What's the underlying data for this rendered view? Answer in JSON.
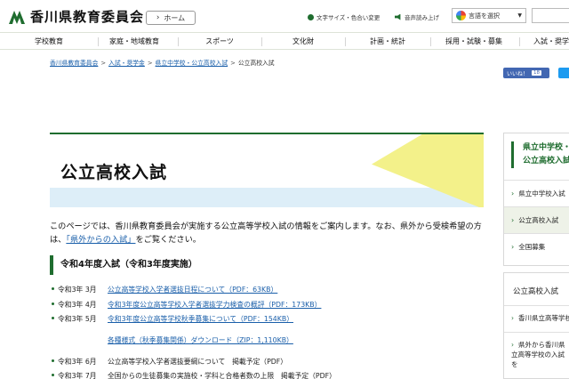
{
  "header": {
    "site_name": "香川県教育委員会",
    "home_label": "ホーム",
    "font_color_label": "文字サイズ・色合い変更",
    "read_aloud_label": "音声読み上げ",
    "translate_label": "言語を選択",
    "translate_caret": "▼"
  },
  "nav": {
    "items": [
      {
        "label": "学校教育"
      },
      {
        "label": "家庭・地域教育"
      },
      {
        "label": "スポーツ"
      },
      {
        "label": "文化財"
      },
      {
        "label": "計画・統計"
      },
      {
        "label": "採用・試験・募集"
      },
      {
        "label": "入試・奨学"
      }
    ]
  },
  "breadcrumb": {
    "items": [
      {
        "label": "香川県教育委員会"
      },
      {
        "label": "入試・奨学金"
      },
      {
        "label": "県立中学校・公立高校入試"
      }
    ],
    "current": "公立高校入試",
    "sep": ">"
  },
  "social": {
    "like_label": "いいね！",
    "like_count": "18"
  },
  "page": {
    "title": "公立高校入試",
    "intro_before": "このページでは、香川県教育委員会が実施する公立高等学校入試の情報をご案内します。なお、県外から受検希望の方は、",
    "intro_link": "「県外からの入試」",
    "intro_after": "をご覧ください。"
  },
  "section": {
    "heading": "令和4年度入試（令和3年度実施）"
  },
  "list": [
    {
      "date": "令和3年 3月",
      "text": "公立高等学校入学者選抜日程について（PDF：63KB）",
      "link": true
    },
    {
      "date": "令和3年 4月",
      "text": "令和3年度公立高等学校入学者選抜学力検査の概評（PDF：173KB）",
      "link": true
    },
    {
      "date": "令和3年 5月",
      "text": "令和3年度公立高等学校秋季募集について（PDF：154KB）",
      "link": true
    },
    {
      "date": "",
      "text": "各種様式（秋季募集関係）ダウンロード（ZIP：1,110KB）",
      "link": true
    },
    {
      "date": "令和3年 6月",
      "text": "公立高等学校入学者選抜要綱について　掲載予定（PDF）",
      "link": false
    },
    {
      "date": "令和3年 7月",
      "text": "全国からの生徒募集の実施校・学科と合格者数の上限　掲載予定（PDF）",
      "link": false
    }
  ],
  "sidebar": {
    "box1_heading": "県立中学校・公立高校入試",
    "box1_items": [
      {
        "label": "県立中学校入試"
      },
      {
        "label": "公立高校入試"
      },
      {
        "label": "全国募集"
      }
    ],
    "box2_heading": "公立高校入試",
    "box2_items": [
      {
        "label": "香川県立高等学校"
      },
      {
        "label": "県外から香川県立高等学校の入試を"
      }
    ]
  },
  "colors": {
    "accent": "#1f6d2f",
    "link": "#1a5faa",
    "band": "#ddeef8",
    "deco": "#f3f18a"
  }
}
